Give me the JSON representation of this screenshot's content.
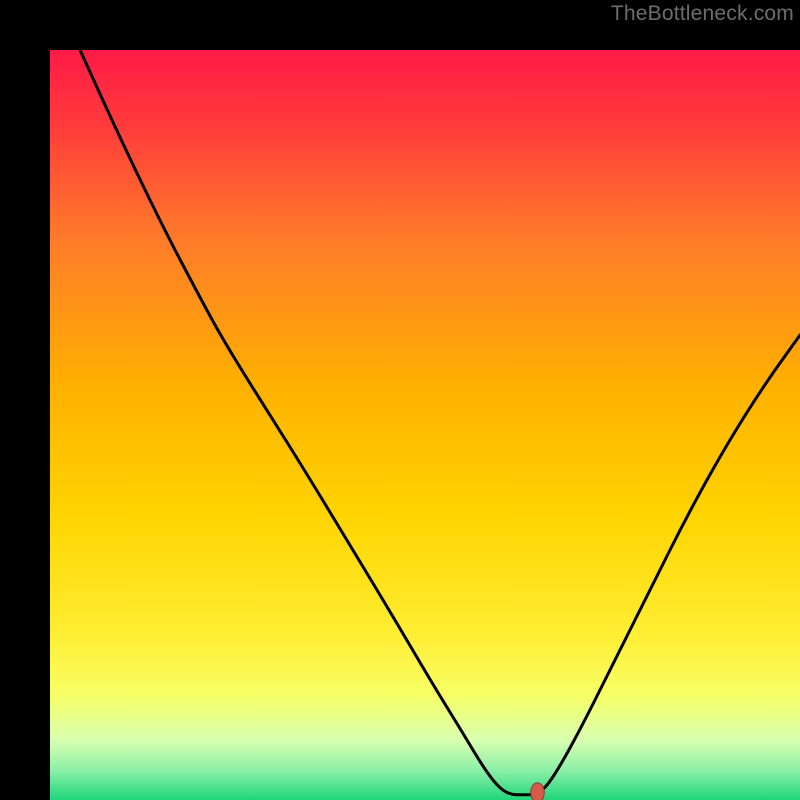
{
  "watermark": "TheBottleneck.com",
  "colors": {
    "curve_stroke": "#000000",
    "marker_fill": "#d75a4a",
    "marker_stroke": "#8a3a30",
    "gradient_stops": [
      {
        "offset": 0.0,
        "color": "#ff1a47"
      },
      {
        "offset": 0.1,
        "color": "#ff3b3b"
      },
      {
        "offset": 0.25,
        "color": "#ff7a2a"
      },
      {
        "offset": 0.45,
        "color": "#ffb100"
      },
      {
        "offset": 0.62,
        "color": "#ffd400"
      },
      {
        "offset": 0.78,
        "color": "#ffee33"
      },
      {
        "offset": 0.86,
        "color": "#f7ff66"
      },
      {
        "offset": 0.92,
        "color": "#d8ffb0"
      },
      {
        "offset": 0.96,
        "color": "#8df0a8"
      },
      {
        "offset": 1.0,
        "color": "#1fd67a"
      }
    ]
  },
  "chart_data": {
    "type": "line",
    "title": "",
    "xlabel": "",
    "ylabel": "",
    "x_range": [
      0,
      100
    ],
    "y_range": [
      0,
      100
    ],
    "xlim": [
      0,
      100
    ],
    "ylim": [
      0,
      100
    ],
    "series": [
      {
        "name": "curve",
        "points": [
          {
            "x": 4.0,
            "y": 100.0
          },
          {
            "x": 9.0,
            "y": 89.0
          },
          {
            "x": 15.0,
            "y": 76.5
          },
          {
            "x": 20.0,
            "y": 67.0
          },
          {
            "x": 23.0,
            "y": 61.5
          },
          {
            "x": 27.0,
            "y": 55.0
          },
          {
            "x": 33.0,
            "y": 45.5
          },
          {
            "x": 40.0,
            "y": 34.0
          },
          {
            "x": 46.0,
            "y": 24.0
          },
          {
            "x": 51.0,
            "y": 15.5
          },
          {
            "x": 55.0,
            "y": 9.0
          },
          {
            "x": 58.0,
            "y": 4.0
          },
          {
            "x": 60.0,
            "y": 1.5
          },
          {
            "x": 61.5,
            "y": 0.7
          },
          {
            "x": 63.0,
            "y": 0.7
          },
          {
            "x": 64.5,
            "y": 0.7
          },
          {
            "x": 66.0,
            "y": 1.5
          },
          {
            "x": 68.0,
            "y": 4.5
          },
          {
            "x": 71.0,
            "y": 10.0
          },
          {
            "x": 75.0,
            "y": 18.0
          },
          {
            "x": 80.0,
            "y": 28.0
          },
          {
            "x": 85.0,
            "y": 38.0
          },
          {
            "x": 90.0,
            "y": 47.0
          },
          {
            "x": 95.0,
            "y": 55.0
          },
          {
            "x": 100.0,
            "y": 62.0
          }
        ]
      }
    ],
    "marker": {
      "x": 65.0,
      "y": 1.0,
      "rx": 0.9,
      "ry": 1.3
    }
  }
}
